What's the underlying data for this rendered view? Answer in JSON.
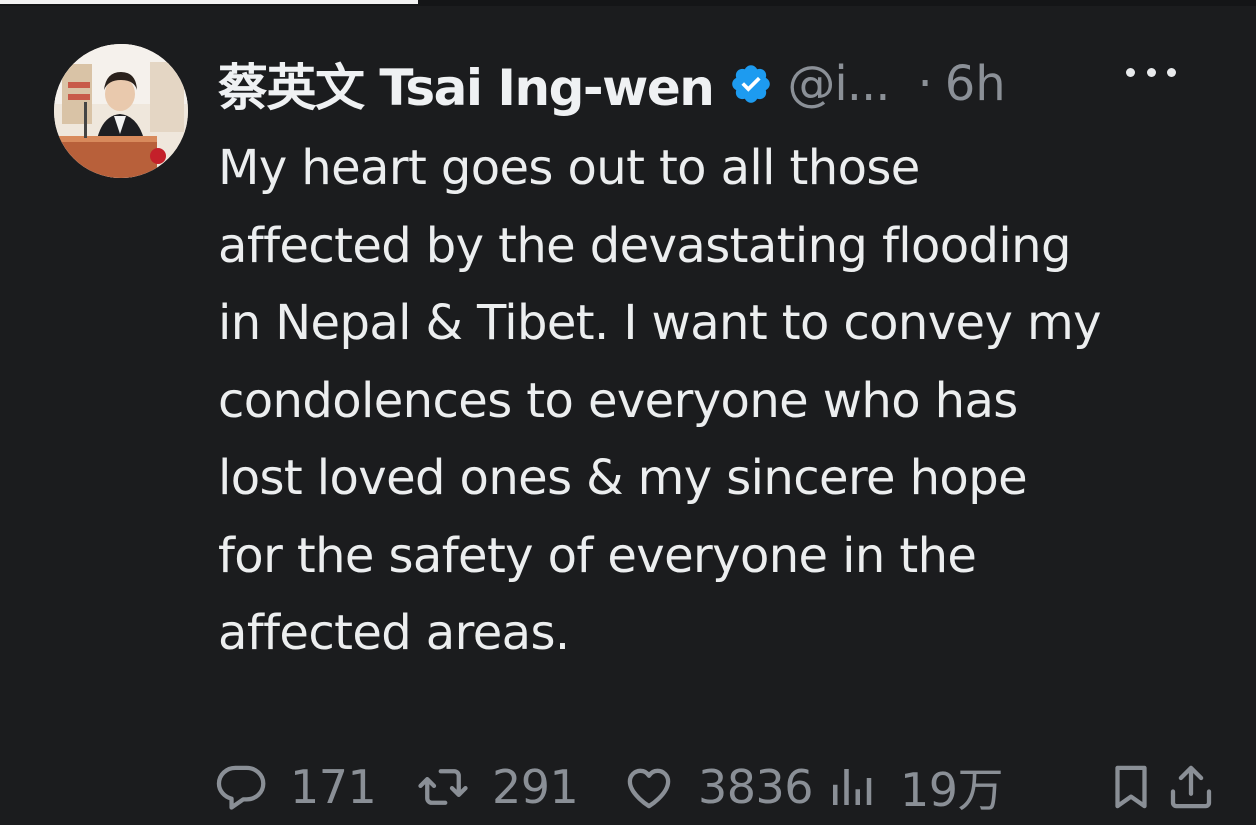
{
  "tweet": {
    "author": {
      "display_name": "蔡英文 Tsai Ing-wen",
      "handle": "@i...",
      "verified": true,
      "avatar": "profile-photo"
    },
    "separator": "·",
    "time": "6h",
    "text": "My heart goes out to all those\naffected by the devastating flooding\nin Nepal & Tibet. I want to convey my\ncondolences to everyone who has\nlost loved ones & my sincere hope\nfor the safety of everyone in the\naffected areas.",
    "actions": {
      "replies": "171",
      "retweets": "291",
      "likes": "3836",
      "views": "19万"
    }
  },
  "icons": {
    "more": "more-icon",
    "verified": "verified-badge-icon",
    "reply": "reply-icon",
    "retweet": "retweet-icon",
    "like": "heart-icon",
    "views": "views-icon",
    "bookmark": "bookmark-icon",
    "share": "share-icon"
  },
  "colors": {
    "background": "#1b1c1e",
    "text": "#eceeef",
    "muted": "#8b9097",
    "verified": "#1d9bf0"
  }
}
